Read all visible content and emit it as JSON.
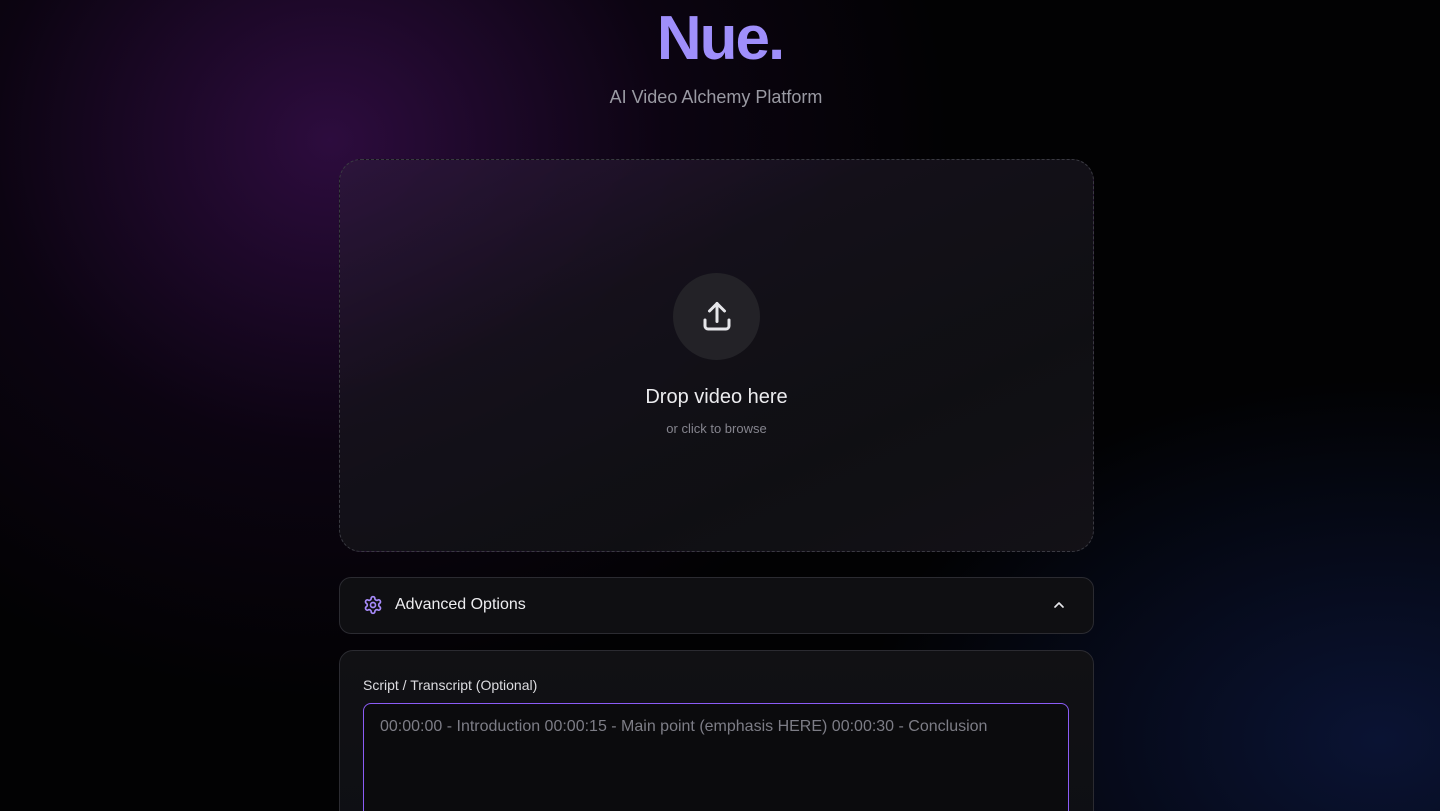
{
  "brand": {
    "title": "Nue.",
    "tagline": "AI Video Alchemy Platform",
    "accent_color": "#9f8ffb"
  },
  "dropzone": {
    "icon": "upload-icon",
    "title": "Drop video here",
    "subtitle": "or click to browse"
  },
  "advanced_options": {
    "icon": "gear-icon",
    "label": "Advanced Options",
    "expanded": true,
    "chevron_icon": "chevron-up-icon"
  },
  "script_panel": {
    "label": "Script / Transcript (Optional)",
    "placeholder": "00:00:00 - Introduction 00:00:15 - Main point (emphasis HERE) 00:00:30 - Conclusion",
    "value": "",
    "focus_color": "#8b5cf6"
  }
}
